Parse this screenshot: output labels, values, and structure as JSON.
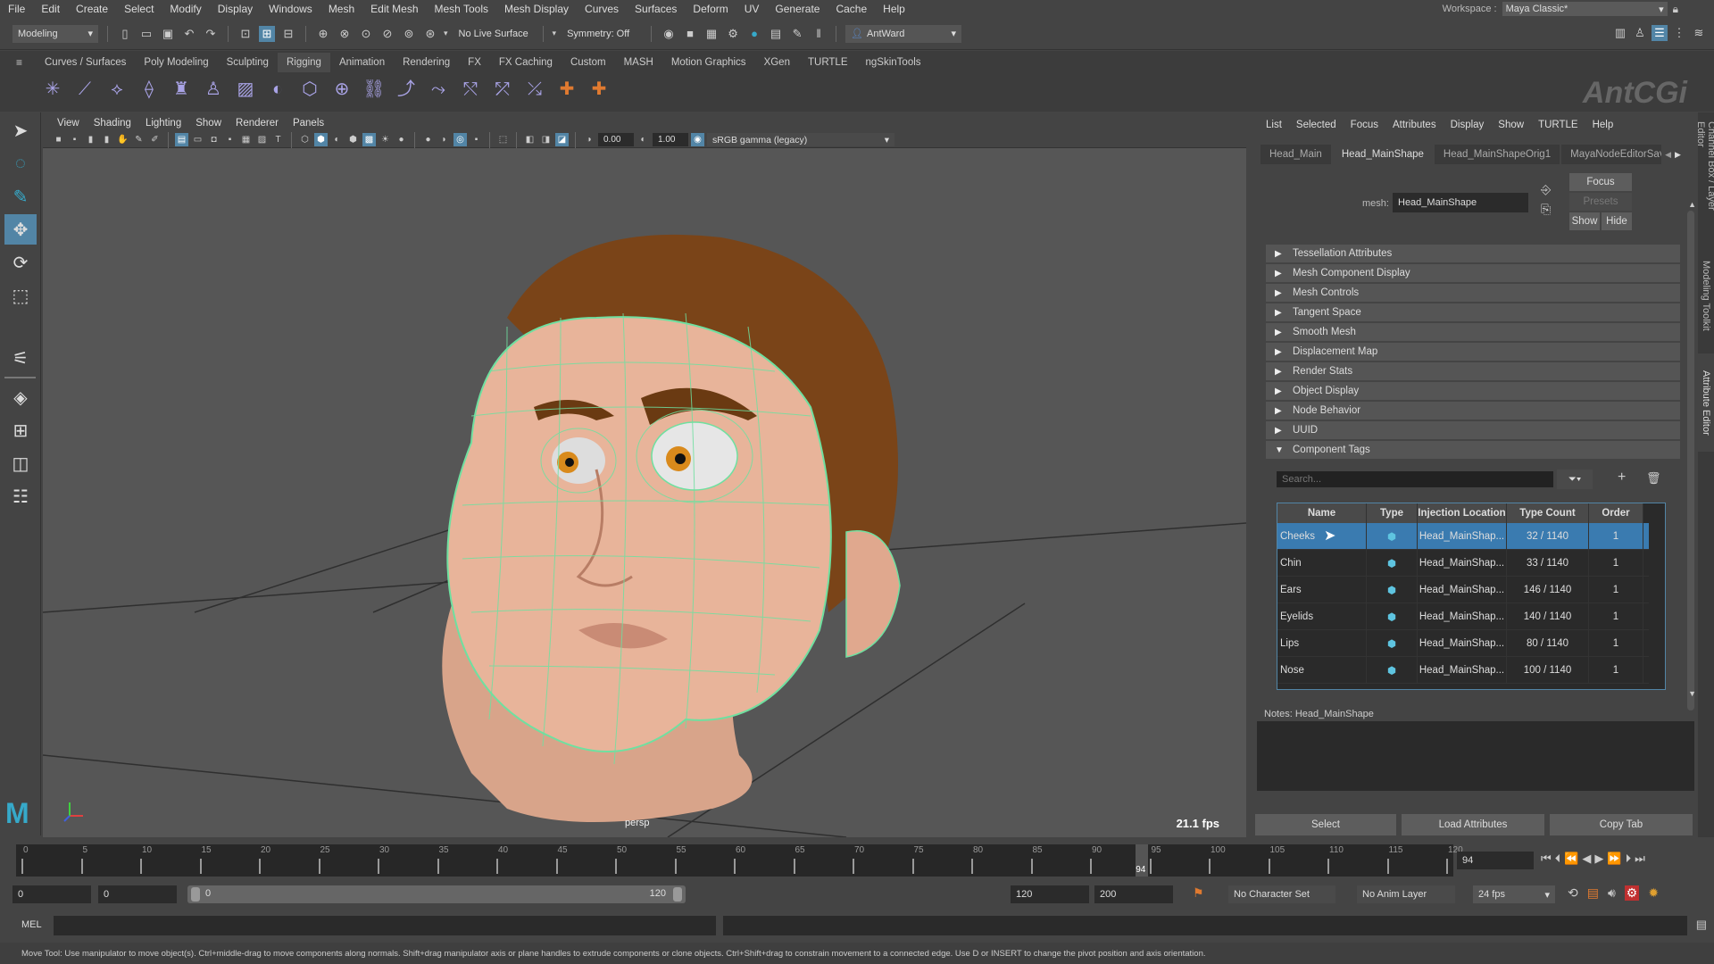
{
  "menubar": {
    "items": [
      "File",
      "Edit",
      "Create",
      "Select",
      "Modify",
      "Display",
      "Windows",
      "Mesh",
      "Edit Mesh",
      "Mesh Tools",
      "Mesh Display",
      "Curves",
      "Surfaces",
      "Deform",
      "UV",
      "Generate",
      "Cache",
      "Help"
    ],
    "workspace_label": "Workspace :",
    "workspace_value": "Maya Classic*"
  },
  "statusline": {
    "menuset": "Modeling",
    "live_surface": "No Live Surface",
    "symmetry": "Symmetry: Off",
    "user": "AntWard"
  },
  "shelf": {
    "tabs": [
      "Curves / Surfaces",
      "Poly Modeling",
      "Sculpting",
      "Rigging",
      "Animation",
      "Rendering",
      "FX",
      "FX Caching",
      "Custom",
      "MASH",
      "Motion Graphics",
      "XGen",
      "TURTLE",
      "ngSkinTools"
    ],
    "active_tab": "Rigging",
    "logo": "AntCGi"
  },
  "viewport": {
    "menu": [
      "View",
      "Shading",
      "Lighting",
      "Show",
      "Renderer",
      "Panels"
    ],
    "exposure": "0.00",
    "gamma": "1.00",
    "color_space": "sRGB gamma (legacy)",
    "camera": "persp",
    "fps": "21.1 fps"
  },
  "attribute_editor": {
    "menu": [
      "List",
      "Selected",
      "Focus",
      "Attributes",
      "Display",
      "Show",
      "TURTLE",
      "Help"
    ],
    "tabs": [
      "Head_Main",
      "Head_MainShape",
      "Head_MainShapeOrig1",
      "MayaNodeEditorSav"
    ],
    "active_tab": "Head_MainShape",
    "mesh_label": "mesh:",
    "mesh_value": "Head_MainShape",
    "focus_btn": "Focus",
    "presets_btn": "Presets",
    "show_btn": "Show",
    "hide_btn": "Hide",
    "sections": [
      {
        "label": "Tessellation Attributes",
        "expanded": false
      },
      {
        "label": "Mesh Component Display",
        "expanded": false
      },
      {
        "label": "Mesh Controls",
        "expanded": false
      },
      {
        "label": "Tangent Space",
        "expanded": false
      },
      {
        "label": "Smooth Mesh",
        "expanded": false
      },
      {
        "label": "Displacement Map",
        "expanded": false
      },
      {
        "label": "Render Stats",
        "expanded": false
      },
      {
        "label": "Object Display",
        "expanded": false
      },
      {
        "label": "Node Behavior",
        "expanded": false
      },
      {
        "label": "UUID",
        "expanded": false
      },
      {
        "label": "Component Tags",
        "expanded": true
      }
    ],
    "search_placeholder": "Search...",
    "table": {
      "columns": [
        "Name",
        "Type",
        "Injection Location",
        "Type Count",
        "Order"
      ],
      "rows": [
        {
          "name": "Cheeks",
          "type": "cube-icon",
          "location": "Head_MainShap...",
          "count": "32 / 1140",
          "order": "1",
          "selected": true
        },
        {
          "name": "Chin",
          "type": "cube-icon",
          "location": "Head_MainShap...",
          "count": "33 / 1140",
          "order": "1",
          "selected": false
        },
        {
          "name": "Ears",
          "type": "cube-icon",
          "location": "Head_MainShap...",
          "count": "146 / 1140",
          "order": "1",
          "selected": false
        },
        {
          "name": "Eyelids",
          "type": "cube-icon",
          "location": "Head_MainShap...",
          "count": "140 / 1140",
          "order": "1",
          "selected": false
        },
        {
          "name": "Lips",
          "type": "cube-icon",
          "location": "Head_MainShap...",
          "count": "80 / 1140",
          "order": "1",
          "selected": false
        },
        {
          "name": "Nose",
          "type": "cube-icon",
          "location": "Head_MainShap...",
          "count": "100 / 1140",
          "order": "1",
          "selected": false
        }
      ]
    },
    "notes": "Notes:  Head_MainShape",
    "bottom_buttons": [
      "Select",
      "Load Attributes",
      "Copy Tab"
    ]
  },
  "side_tabs": [
    "Channel Box / Layer Editor",
    "Modeling Toolkit",
    "Attribute Editor"
  ],
  "timeline": {
    "ticks": [
      "0",
      "5",
      "10",
      "15",
      "20",
      "25",
      "30",
      "35",
      "40",
      "45",
      "50",
      "55",
      "60",
      "65",
      "70",
      "75",
      "80",
      "85",
      "90",
      "95",
      "100",
      "105",
      "110",
      "115",
      "120"
    ],
    "current_frame": "94",
    "current_frame_field": "94"
  },
  "range": {
    "start": "0",
    "anim_start": "0",
    "slider_start": "0",
    "slider_end": "120",
    "end": "120",
    "anim_end": "200",
    "character_set": "No Character Set",
    "anim_layer": "No Anim Layer",
    "fps": "24 fps"
  },
  "command": {
    "label": "MEL"
  },
  "helpline": "Move Tool: Use manipulator to move object(s). Ctrl+middle-drag to move components along normals. Shift+drag manipulator axis or plane handles to extrude components or clone objects. Ctrl+Shift+drag to constrain movement to a connected edge. Use D or INSERT to change the pivot position and axis orientation.",
  "colors": {
    "accent": "#5285a6",
    "selection": "#3a7bb0",
    "wireframe": "#6fe0a0",
    "skin": "#e8b49a",
    "hair": "#7a4418"
  }
}
